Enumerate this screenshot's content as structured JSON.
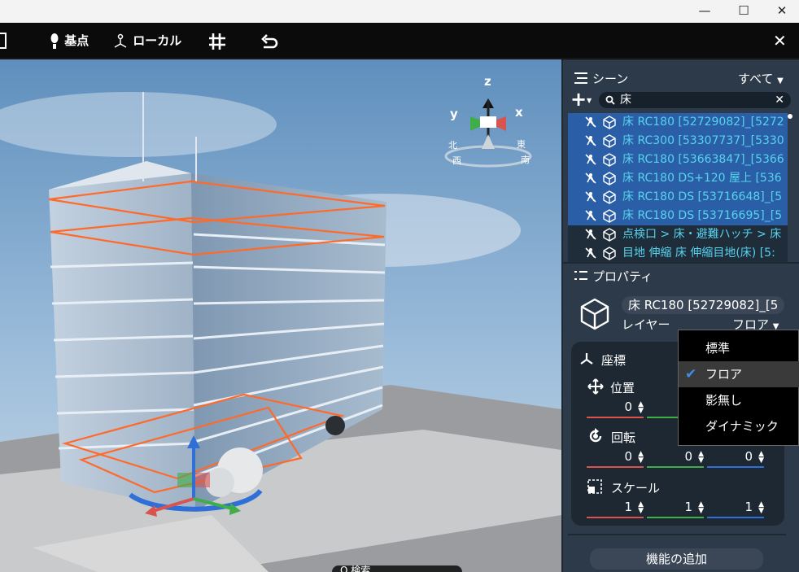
{
  "window": {
    "minimize_glyph": "—",
    "maximize_glyph": "☐",
    "close_glyph": "✕"
  },
  "toolbar": {
    "base_point_label": "基点",
    "local_label": "ローカル",
    "grid_icon": "grid-icon",
    "undo_icon": "undo-icon",
    "close_glyph": "✕"
  },
  "viewport": {
    "gizmo": {
      "z": "z",
      "x": "x",
      "y": "y",
      "north": "北",
      "east": "東",
      "west": "西",
      "south": "南"
    },
    "bottom_search_partial": "Q 検索"
  },
  "scene": {
    "title": "シーン",
    "filter": "すべて",
    "search_value": "床",
    "clear_glyph": "✕",
    "rows": [
      {
        "text": "床 RC180 [52729082]_[5272",
        "selected": true
      },
      {
        "text": "床 RC300 [53307737]_[5330",
        "selected": true
      },
      {
        "text": "床 RC180 [53663847]_[5366",
        "selected": true
      },
      {
        "text": "床 RC180 DS+120 屋上 [536",
        "selected": true
      },
      {
        "text": "床 RC180 DS [53716648]_[5",
        "selected": true
      },
      {
        "text": "床 RC180 DS [53716695]_[5",
        "selected": true
      },
      {
        "text": "点検口 > 床・避難ハッチ > 床",
        "selected": false
      },
      {
        "text": "目地 伸縮 床 伸縮目地(床) [5:",
        "selected": false
      }
    ]
  },
  "properties": {
    "title": "プロパティ",
    "object_name": "床 RC180 [52729082]_[5",
    "layer_label": "レイヤー",
    "layer_value": "フロア",
    "coords_title": "座標",
    "position_label": "位置",
    "position_values": [
      "0"
    ],
    "rotation_label": "回転",
    "rotation_values": [
      "0",
      "0",
      "0"
    ],
    "scale_label": "スケール",
    "scale_values": [
      "1",
      "1",
      "1"
    ],
    "add_function_label": "機能の追加"
  },
  "layer_menu": {
    "items": [
      {
        "label": "標準",
        "checked": false
      },
      {
        "label": "フロア",
        "checked": true
      },
      {
        "label": "影無し",
        "checked": false
      },
      {
        "label": "ダイナミック",
        "checked": false
      }
    ],
    "check_glyph": "✔"
  },
  "colors": {
    "selected_row": "#2a5ea6",
    "row_text": "#57d3ee",
    "panel_bg": "#2c3a49",
    "highlight_orange": "#ff6a2a",
    "axis_x": "#d9534f",
    "axis_y": "#3fae49",
    "axis_z": "#2f6fd8"
  }
}
